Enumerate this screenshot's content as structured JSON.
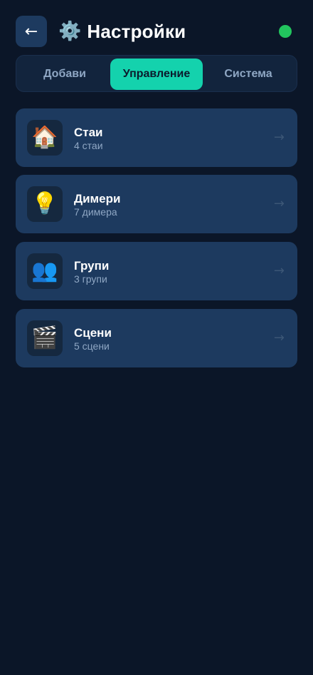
{
  "header": {
    "back_icon": "←",
    "title_icon": "⚙️",
    "title": "Настройки",
    "status_color": "#22c55e"
  },
  "tabs": [
    {
      "label": "Добави",
      "active": false
    },
    {
      "label": "Управление",
      "active": true
    },
    {
      "label": "Система",
      "active": false
    }
  ],
  "cards": [
    {
      "icon": "🏠",
      "icon_name": "house-icon",
      "title": "Стаи",
      "subtitle": "4 стаи",
      "arrow": "→"
    },
    {
      "icon": "💡",
      "icon_name": "lightbulb-icon",
      "title": "Димери",
      "subtitle": "7 димера",
      "arrow": "→"
    },
    {
      "icon": "👥",
      "icon_name": "people-icon",
      "title": "Групи",
      "subtitle": "3 групи",
      "arrow": "→"
    },
    {
      "icon": "🎬",
      "icon_name": "clapperboard-icon",
      "title": "Сцени",
      "subtitle": "5 сцени",
      "arrow": "→"
    }
  ],
  "colors": {
    "background": "#0b1628",
    "card": "#1d3a5f",
    "accent": "#14d2ad"
  }
}
